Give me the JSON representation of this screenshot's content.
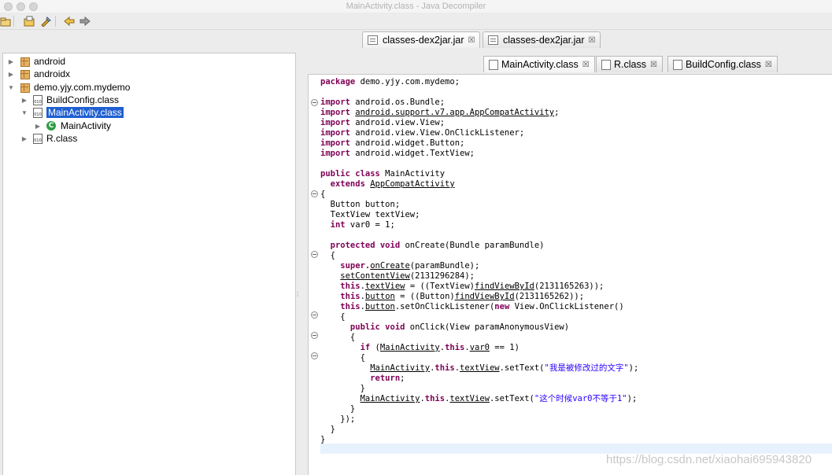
{
  "window": {
    "title": "MainActivity.class - Java Decompiler"
  },
  "toolbar": {
    "icons": [
      "open-file-icon",
      "open-folder-icon",
      "tool-icon",
      "back-icon",
      "forward-icon"
    ]
  },
  "jar_tabs": [
    {
      "label": "classes-dex2jar.jar",
      "close": "☒"
    },
    {
      "label": "classes-dex2jar.jar",
      "close": "☒"
    }
  ],
  "tree": [
    {
      "label": "android",
      "arrow": "▶",
      "icon": "package-icon"
    },
    {
      "label": "androidx",
      "arrow": "▶",
      "icon": "package-icon"
    },
    {
      "label": "demo.yjy.com.mydemo",
      "arrow": "▼",
      "icon": "package-icon"
    },
    {
      "label": "BuildConfig.class",
      "arrow": "▶",
      "icon": "class-file-icon"
    },
    {
      "label": "MainActivity.class",
      "arrow": "▼",
      "icon": "class-file-icon",
      "selected": true
    },
    {
      "label": "MainActivity",
      "arrow": "▶",
      "icon": "class-icon",
      "badge": "C"
    },
    {
      "label": "R.class",
      "arrow": "▶",
      "icon": "class-file-icon"
    }
  ],
  "class_tabs": [
    {
      "label": "MainActivity.class",
      "close": "☒",
      "active": true
    },
    {
      "label": "R.class",
      "close": "☒"
    },
    {
      "label": "BuildConfig.class",
      "close": "☒"
    }
  ],
  "code": {
    "l01_kw": "package",
    "l01_rest": " demo.yjy.com.mydemo;",
    "imp": "import",
    "l03_rest": " android.os.Bundle;",
    "l04_rest": "android.support.v7.app.AppCompatActivity",
    "l05_rest": " android.view.View;",
    "l06_rest": " android.view.View.OnClickListener;",
    "l07_rest": " android.widget.Button;",
    "l08_rest": " android.widget.TextView;",
    "l10_kw": "public class",
    "l10_rest": " MainActivity",
    "l11_kw": "  extends",
    "l11_rest": "AppCompatActivity",
    "l12": "{",
    "l13": "  Button button;",
    "l14": "  TextView textView;",
    "l15_kw": "  int",
    "l15_rest": " var0 = 1;",
    "l17_kw": "  protected void",
    "l17_rest": " onCreate(Bundle paramBundle)",
    "l18": "  {",
    "l19_kw": "    super.",
    "l19_link": "onCreate",
    "l19_rest": "(paramBundle);",
    "l20_link": "setContentView",
    "l20_rest": "(2131296284);",
    "this": "this",
    "l21_link": "textView",
    "l21_mid": " = ((TextView)",
    "l21_link2": "findViewById",
    "l21_rest": "(2131165263));",
    "l22_link": "button",
    "l22_mid": " = ((Button)",
    "l22_link2": "findViewById",
    "l22_rest": "(2131165262));",
    "l23_link": "button",
    "l23_mid": ".setOnClickListener(",
    "l23_new": "new",
    "l23_rest": " View.OnClickListener()",
    "l24": "    {",
    "l25_kw": "      public void",
    "l25_rest": " onClick(View paramAnonymousView)",
    "l26": "      {",
    "l27_kw": "        if",
    "l27_a": " (",
    "l27_link": "MainActivity",
    "l27_dot": ".",
    "l27_link2": "var0",
    "l27_rest": " == 1)",
    "l28": "        {",
    "l29_link": "MainActivity",
    "l29_dot": ".",
    "l29_link2": "textView",
    "l29_mid": ".setText(",
    "l29_str": "\"我是被修改过的文字\"",
    "l29_rest": ");",
    "l30_kw": "return",
    "l30_rest": ";",
    "l31": "        }",
    "l32_link": "MainActivity",
    "l32_dot": ".",
    "l32_link2": "textView",
    "l32_mid": ".setText(",
    "l32_str": "\"这个时候var0不等于1\"",
    "l32_rest": ");",
    "l33": "      }",
    "l34": "    });",
    "l35": "  }",
    "l36": "}"
  },
  "watermark": "https://blog.csdn.net/xiaohai695943820"
}
